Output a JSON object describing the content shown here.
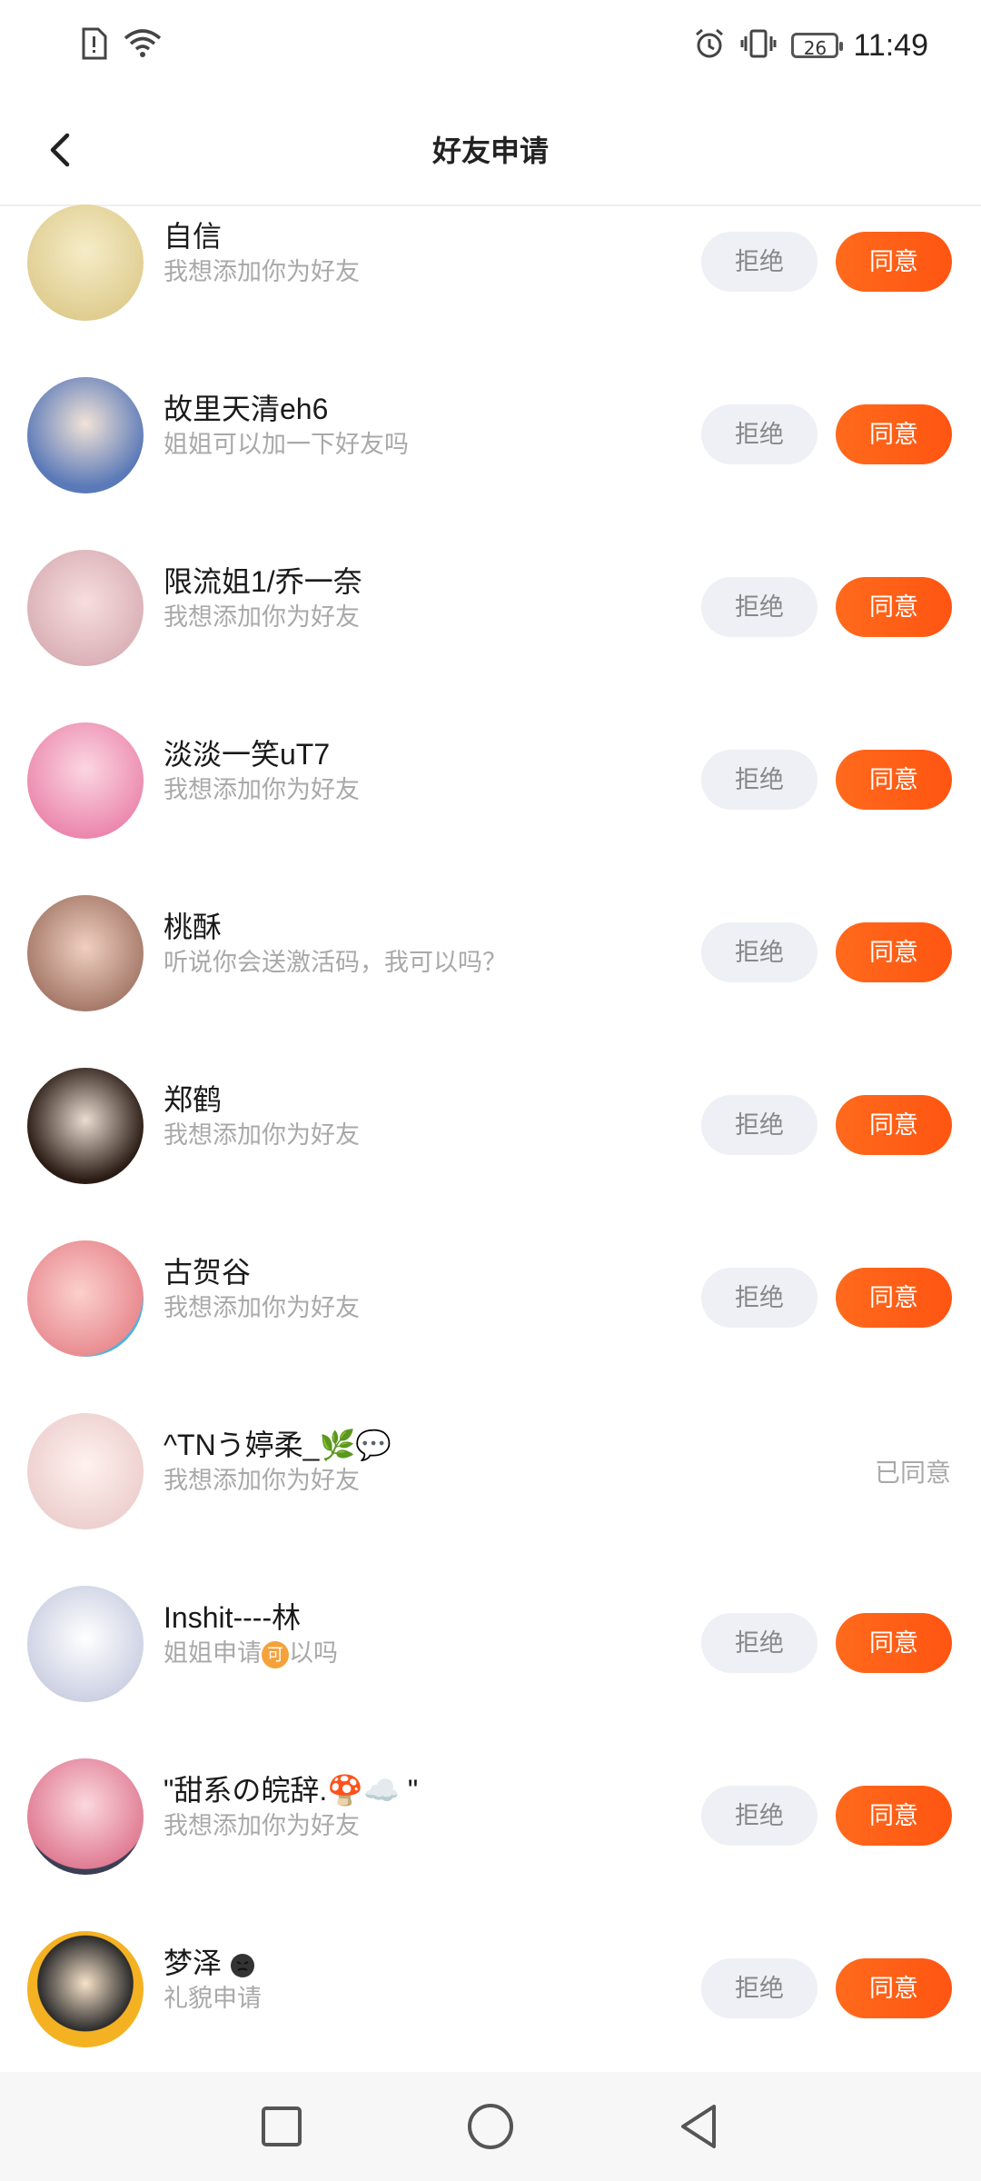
{
  "status_bar": {
    "time": "11:49",
    "battery": "26"
  },
  "header": {
    "title": "好友申请"
  },
  "requests": [
    {
      "name": "自信",
      "message": "我想添加你为好友",
      "state": "pending",
      "avatar_color": "#e9d69a"
    },
    {
      "name": "故里天清eh6",
      "message": "姐姐可以加一下好友吗",
      "state": "pending",
      "avatar_color": "#7aa7e6"
    },
    {
      "name": "限流姐1/乔一奈",
      "message": "我想添加你为好友",
      "state": "pending",
      "avatar_color": "#e7b8b8"
    },
    {
      "name": "淡淡一笑uT7",
      "message": "我想添加你为好友",
      "state": "pending",
      "avatar_color": "#f29dbb"
    },
    {
      "name": "桃酥",
      "message": "听说你会送激活码，我可以吗？",
      "state": "pending",
      "avatar_color": "#b98b7a"
    },
    {
      "name": "郑鹤",
      "message": "我想添加你为好友",
      "state": "pending",
      "avatar_color": "#3a2a22"
    },
    {
      "name": "古贺谷",
      "message": "我想添加你为好友",
      "state": "pending",
      "avatar_color": "#f4a1a9"
    },
    {
      "name": "^TNう婷柔_🌿💬",
      "message": "我想添加你为好友",
      "state": "accepted",
      "avatar_color": "#f2d6d6"
    },
    {
      "name": "Inshit----林",
      "message_pre": "姐姐申请",
      "badge": "可",
      "message_post": "以吗",
      "state": "pending",
      "avatar_color": "#cfd4e6"
    },
    {
      "name": "\"甜系の皖辞.🍄☁️ \"",
      "message": "我想添加你为好友",
      "state": "pending",
      "avatar_color": "#f0a3b5"
    },
    {
      "name": "梦泽",
      "message": "礼貌申请",
      "state": "pending",
      "avatar_color": "#f4b223"
    }
  ],
  "labels": {
    "reject": "拒绝",
    "accept": "同意",
    "accepted": "已同意"
  },
  "colors": {
    "accent": "#ff5d16",
    "reject_bg": "#eef0f5",
    "muted": "#a9a9a9"
  }
}
